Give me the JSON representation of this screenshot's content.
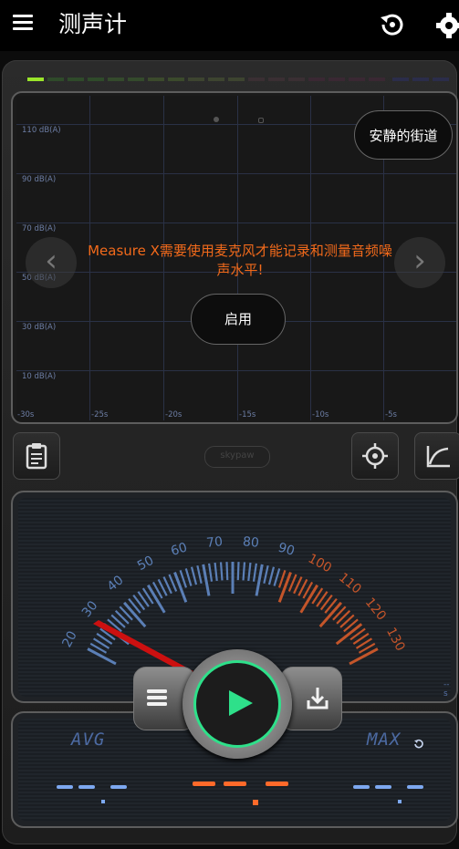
{
  "appbar": {
    "title": "测声计",
    "icons": [
      "menu-icon",
      "history-icon",
      "settings-icon"
    ]
  },
  "graph": {
    "y_labels": [
      "110 dB(A)",
      "90 dB(A)",
      "70 dB(A)",
      "50 dB(A)",
      "30 dB(A)",
      "10 dB(A)"
    ],
    "x_labels": [
      "-30s",
      "-25s",
      "-20s",
      "-15s",
      "-10s",
      "-5s"
    ],
    "preset_label": "安静的街道",
    "permission_message": "Measure X需要使用麦克风才能记录和测量音频噪声水平!",
    "enable_label": "启用"
  },
  "tools": {
    "logo_text": "skypaw",
    "icons": [
      "clipboard-icon",
      "crosshair-icon",
      "curve-chart-icon"
    ]
  },
  "meter": {
    "scale_labels": [
      "20",
      "30",
      "40",
      "50",
      "60",
      "70",
      "80",
      "90",
      "100",
      "110",
      "120",
      "130"
    ],
    "time_label": "--s",
    "colors": {
      "low": "#5b7fb6",
      "high": "#c4552a",
      "needle": "#cc1010",
      "play_ring": "#2ee08a"
    }
  },
  "stats": {
    "avg_label": "AVG",
    "max_label": "MAX",
    "colors": {
      "side_dash": "#7da8f0",
      "center_dash": "#ff6a2a"
    }
  }
}
